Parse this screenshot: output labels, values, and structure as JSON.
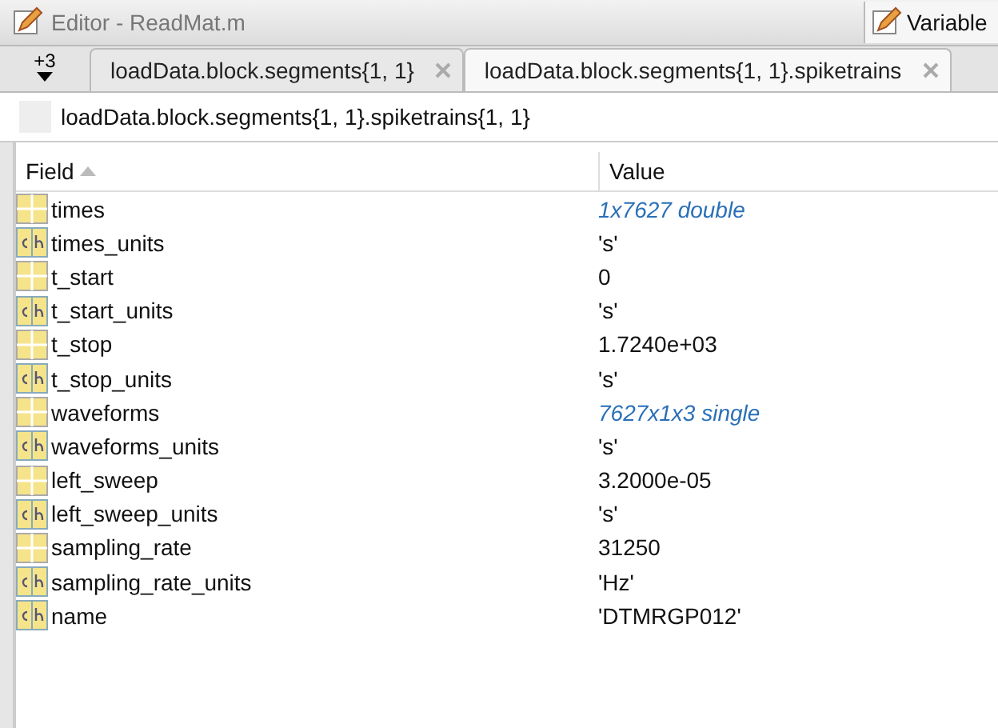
{
  "editor_bar": {
    "title": "Editor - ReadMat.m",
    "variables_tab": "Variable"
  },
  "tabs": {
    "overflow": "+3",
    "items": [
      {
        "label": "loadData.block.segments{1, 1}",
        "selected": false
      },
      {
        "label": "loadData.block.segments{1, 1}.spiketrains",
        "selected": true
      }
    ]
  },
  "path": "loadData.block.segments{1, 1}.spiketrains{1, 1}",
  "table": {
    "columns": [
      {
        "label": "Field",
        "sorted": true
      },
      {
        "label": "Value",
        "sorted": false
      }
    ],
    "rows": [
      {
        "kind": "numeric",
        "field": "times",
        "value": "1x7627 double",
        "summary": true
      },
      {
        "kind": "char",
        "field": "times_units",
        "value": "'s'",
        "summary": false
      },
      {
        "kind": "numeric",
        "field": "t_start",
        "value": "0",
        "summary": false
      },
      {
        "kind": "char",
        "field": "t_start_units",
        "value": "'s'",
        "summary": false
      },
      {
        "kind": "numeric",
        "field": "t_stop",
        "value": "1.7240e+03",
        "summary": false
      },
      {
        "kind": "char",
        "field": "t_stop_units",
        "value": "'s'",
        "summary": false
      },
      {
        "kind": "numeric",
        "field": "waveforms",
        "value": "7627x1x3 single",
        "summary": true
      },
      {
        "kind": "char",
        "field": "waveforms_units",
        "value": "'s'",
        "summary": false
      },
      {
        "kind": "numeric",
        "field": "left_sweep",
        "value": "3.2000e-05",
        "summary": false
      },
      {
        "kind": "char",
        "field": "left_sweep_units",
        "value": "'s'",
        "summary": false
      },
      {
        "kind": "numeric",
        "field": "sampling_rate",
        "value": "31250",
        "summary": false
      },
      {
        "kind": "char",
        "field": "sampling_rate_units",
        "value": "'Hz'",
        "summary": false
      },
      {
        "kind": "char",
        "field": "name",
        "value": "'DTMRGP012'",
        "summary": false
      }
    ]
  }
}
